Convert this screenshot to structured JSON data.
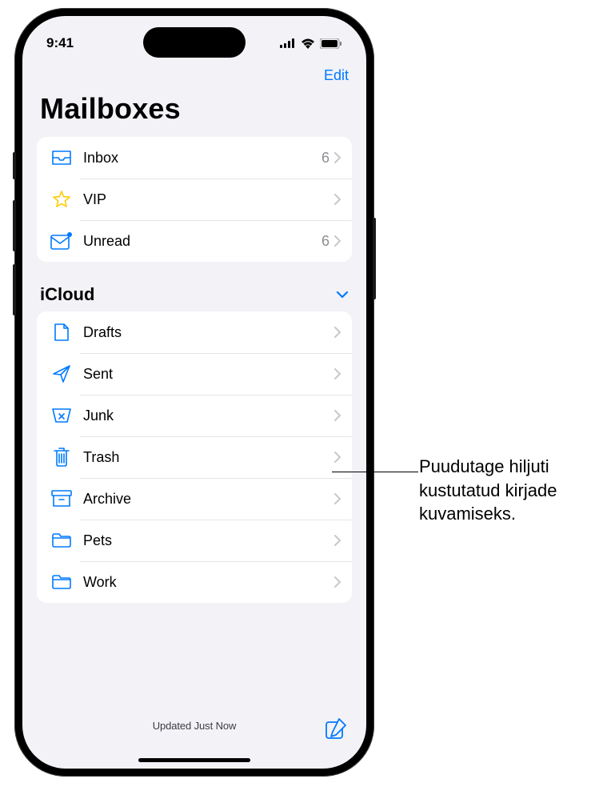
{
  "statusBar": {
    "time": "9:41"
  },
  "nav": {
    "editLabel": "Edit"
  },
  "title": "Mailboxes",
  "smartMailboxes": [
    {
      "icon": "inbox",
      "label": "Inbox",
      "count": "6"
    },
    {
      "icon": "star",
      "label": "VIP",
      "count": ""
    },
    {
      "icon": "unread",
      "label": "Unread",
      "count": "6"
    }
  ],
  "account": {
    "name": "iCloud",
    "folders": [
      {
        "icon": "drafts",
        "label": "Drafts"
      },
      {
        "icon": "sent",
        "label": "Sent"
      },
      {
        "icon": "junk",
        "label": "Junk"
      },
      {
        "icon": "trash",
        "label": "Trash"
      },
      {
        "icon": "archive",
        "label": "Archive"
      },
      {
        "icon": "folder",
        "label": "Pets"
      },
      {
        "icon": "folder",
        "label": "Work"
      }
    ]
  },
  "toolbar": {
    "status": "Updated Just Now"
  },
  "callout": {
    "text": "Puudutage hiljuti kustutatud kirjade kuvamiseks."
  }
}
